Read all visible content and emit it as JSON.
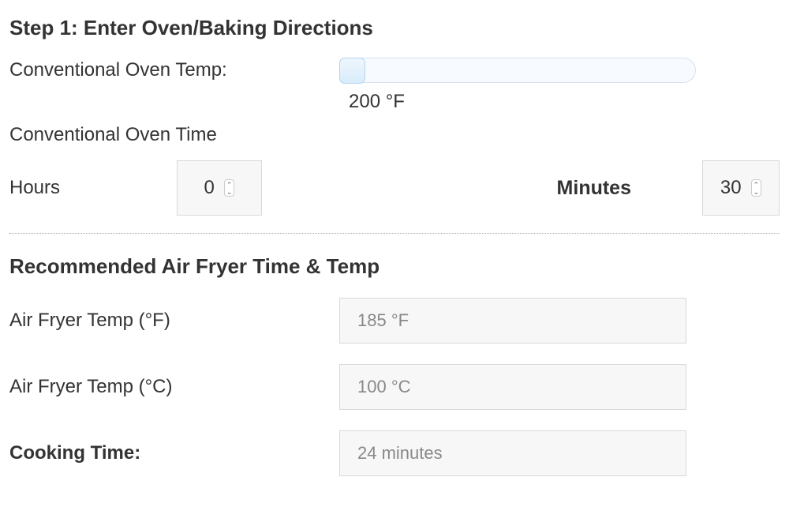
{
  "step1": {
    "heading": "Step 1: Enter Oven/Baking Directions",
    "oven_temp_label": "Conventional Oven Temp:",
    "oven_temp_value": "200 °F",
    "oven_time_label": "Conventional Oven Time",
    "hours_label": "Hours",
    "hours_value": "0",
    "minutes_label": "Minutes",
    "minutes_value": "30"
  },
  "results": {
    "heading": "Recommended Air Fryer Time & Temp",
    "temp_f_label": "Air Fryer Temp (°F)",
    "temp_f_value": "185 °F",
    "temp_c_label": "Air Fryer Temp (°C)",
    "temp_c_value": "100 °C",
    "time_label": "Cooking Time:",
    "time_value": "24 minutes"
  }
}
